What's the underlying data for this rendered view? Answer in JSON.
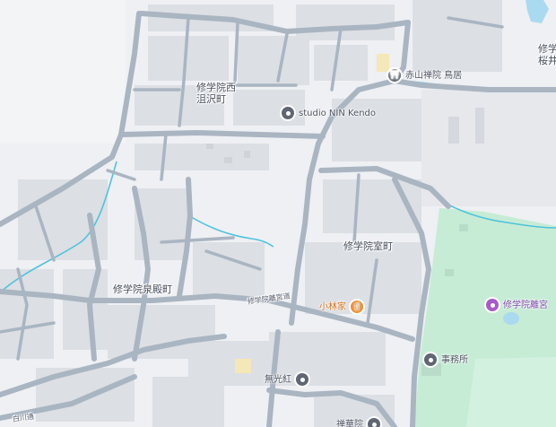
{
  "map": {
    "colors": {
      "background": "#eef0f3",
      "block": "#dcdfe4",
      "road": "#aab5c2",
      "park": "#c6ecd6",
      "water": "#4fc3dc",
      "pond": "#aadaf0"
    },
    "districts": [
      {
        "id": "nishi-sawa",
        "line1": "修学院西",
        "line2": "沮沢町"
      },
      {
        "id": "muro",
        "line1": "修学院室町",
        "line2": ""
      },
      {
        "id": "izumi",
        "line1": "修学院泉殿町",
        "line2": ""
      },
      {
        "id": "edge",
        "line1": "修学",
        "line2": "桜井"
      }
    ],
    "roads": [
      {
        "id": "main-road",
        "label": "修学院離宮道"
      },
      {
        "id": "bottom-road",
        "label": "白川通"
      }
    ],
    "pois": [
      {
        "id": "akayama",
        "label": "赤山禅院 鳥居",
        "icon": "torii-icon",
        "style": "gray"
      },
      {
        "id": "studio",
        "label": "studio NIN Kendo",
        "icon": "location-pin-icon",
        "style": "gray"
      },
      {
        "id": "kobayashi",
        "label": "小林家",
        "icon": "restaurant-icon",
        "style": "orange"
      },
      {
        "id": "rikyu",
        "label": "修学院離宮",
        "icon": "landmark-icon",
        "style": "purple"
      },
      {
        "id": "office",
        "label": "事務所",
        "icon": "location-pin-icon",
        "style": "gray"
      },
      {
        "id": "muko",
        "label": "無光紅",
        "icon": "location-pin-icon",
        "style": "gray"
      },
      {
        "id": "temple",
        "label": "禅華院",
        "icon": "location-pin-icon",
        "style": "gray"
      }
    ]
  }
}
